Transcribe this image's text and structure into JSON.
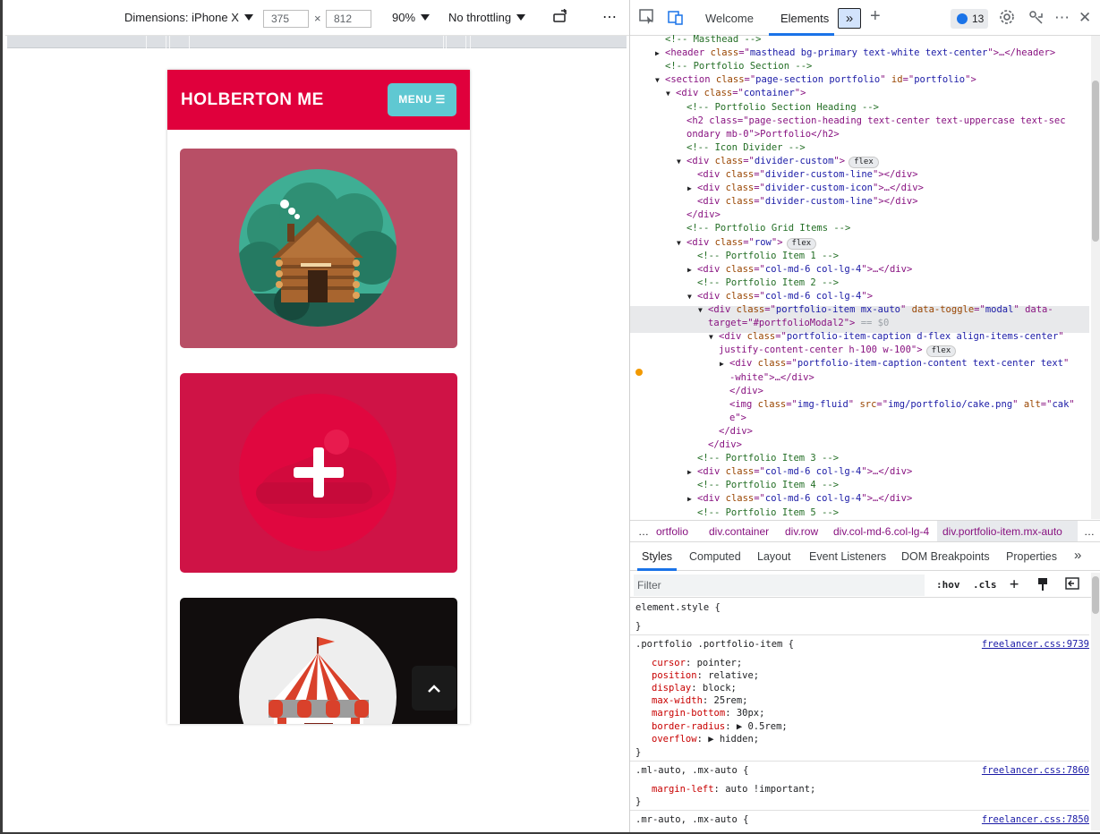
{
  "device_toolbar": {
    "dimensions_label": "Dimensions: iPhone X",
    "width_value": "375",
    "times_sign": "×",
    "height_value": "812",
    "zoom": "90%",
    "throttling": "No throttling",
    "more_label": "⋯"
  },
  "site": {
    "brand": "HOLBERTON ME",
    "menu_label": "MENU ☰",
    "scroll_top_glyph": "⌃"
  },
  "devtools": {
    "tabs": {
      "welcome": "Welcome",
      "elements": "Elements",
      "more": "»",
      "add": "+"
    },
    "issues_count": "13",
    "close_glyph": "✕",
    "more_glyph": "⋯",
    "dom": [
      {
        "indent": 2,
        "arrow": "",
        "kind": "comment",
        "text": "<!-- Masthead -->"
      },
      {
        "indent": 2,
        "arrow": "▶",
        "kind": "open",
        "tag": "header",
        "attrs": [
          [
            "class",
            "masthead bg-primary text-white text-center"
          ]
        ],
        "tail": ">…</header>"
      },
      {
        "indent": 2,
        "arrow": "",
        "kind": "comment",
        "text": "<!-- Portfolio Section -->"
      },
      {
        "indent": 2,
        "arrow": "▼",
        "kind": "open",
        "tag": "section",
        "attrs": [
          [
            "class",
            "page-section portfolio"
          ],
          [
            "id",
            "portfolio"
          ]
        ],
        "tail": ">"
      },
      {
        "indent": 3,
        "arrow": "▼",
        "kind": "open",
        "tag": "div",
        "attrs": [
          [
            "class",
            "container"
          ]
        ],
        "tail": ">"
      },
      {
        "indent": 4,
        "arrow": "",
        "kind": "comment",
        "text": "<!-- Portfolio Section Heading -->"
      },
      {
        "indent": 4,
        "arrow": "",
        "kind": "raw",
        "text": "<h2 class=\"page-section-heading text-center text-uppercase text-sec"
      },
      {
        "indent": 4,
        "arrow": "",
        "kind": "raw",
        "text": "ondary mb-0\">Portfolio</h2>"
      },
      {
        "indent": 4,
        "arrow": "",
        "kind": "comment",
        "text": "<!-- Icon Divider -->"
      },
      {
        "indent": 4,
        "arrow": "▼",
        "kind": "open",
        "tag": "div",
        "attrs": [
          [
            "class",
            "divider-custom"
          ]
        ],
        "tail": ">",
        "badge": "flex"
      },
      {
        "indent": 5,
        "arrow": "",
        "kind": "open",
        "tag": "div",
        "attrs": [
          [
            "class",
            "divider-custom-line"
          ]
        ],
        "tail": "></div>"
      },
      {
        "indent": 5,
        "arrow": "▶",
        "kind": "open",
        "tag": "div",
        "attrs": [
          [
            "class",
            "divider-custom-icon"
          ]
        ],
        "tail": ">…</div>"
      },
      {
        "indent": 5,
        "arrow": "",
        "kind": "open",
        "tag": "div",
        "attrs": [
          [
            "class",
            "divider-custom-line"
          ]
        ],
        "tail": "></div>"
      },
      {
        "indent": 4,
        "arrow": "",
        "kind": "close",
        "text": "</div>"
      },
      {
        "indent": 4,
        "arrow": "",
        "kind": "comment",
        "text": "<!-- Portfolio Grid Items -->"
      },
      {
        "indent": 4,
        "arrow": "▼",
        "kind": "open",
        "tag": "div",
        "attrs": [
          [
            "class",
            "row"
          ]
        ],
        "tail": ">",
        "badge": "flex"
      },
      {
        "indent": 5,
        "arrow": "",
        "kind": "comment",
        "text": "<!-- Portfolio Item 1 -->"
      },
      {
        "indent": 5,
        "arrow": "▶",
        "kind": "open",
        "tag": "div",
        "attrs": [
          [
            "class",
            "col-md-6 col-lg-4"
          ]
        ],
        "tail": ">…</div>"
      },
      {
        "indent": 5,
        "arrow": "",
        "kind": "comment",
        "text": "<!-- Portfolio Item 2 -->"
      },
      {
        "indent": 5,
        "arrow": "▼",
        "kind": "open",
        "tag": "div",
        "attrs": [
          [
            "class",
            "col-md-6 col-lg-4"
          ]
        ],
        "tail": ">"
      },
      {
        "indent": 6,
        "arrow": "▼",
        "kind": "open",
        "tag": "div",
        "attrs": [
          [
            "class",
            "portfolio-item mx-auto"
          ],
          [
            "data-toggle",
            "modal"
          ]
        ],
        "tail": " data-",
        "selected": true
      },
      {
        "indent": 6,
        "arrow": "",
        "kind": "raw2",
        "text": "target=\"#portfolioModal2\">",
        "suffix": " == $0"
      },
      {
        "indent": 7,
        "arrow": "▼",
        "kind": "open",
        "tag": "div",
        "attrs": [
          [
            "class",
            "portfolio-item-caption d-flex align-items-center"
          ]
        ],
        "tail": ""
      },
      {
        "indent": 7,
        "arrow": "",
        "kind": "raw",
        "text": "justify-content-center h-100 w-100\">",
        "badge": "flex"
      },
      {
        "indent": 8,
        "arrow": "▶",
        "kind": "open",
        "tag": "div",
        "attrs": [
          [
            "class",
            "portfolio-item-caption-content text-center text"
          ]
        ],
        "tail": ""
      },
      {
        "indent": 8,
        "arrow": "",
        "kind": "raw",
        "text": "-white\">…</div>"
      },
      {
        "indent": 8,
        "arrow": "",
        "kind": "close",
        "text": "</div>"
      },
      {
        "indent": 8,
        "arrow": "",
        "kind": "open",
        "tag": "img",
        "attrs": [
          [
            "class",
            "img-fluid"
          ],
          [
            "src",
            "img/portfolio/cake.png"
          ],
          [
            "alt",
            "cak"
          ]
        ],
        "tail": ""
      },
      {
        "indent": 8,
        "arrow": "",
        "kind": "raw",
        "text": "e\">"
      },
      {
        "indent": 7,
        "arrow": "",
        "kind": "close",
        "text": "</div>"
      },
      {
        "indent": 6,
        "arrow": "",
        "kind": "close",
        "text": "</div>"
      },
      {
        "indent": 5,
        "arrow": "",
        "kind": "comment",
        "text": "<!-- Portfolio Item 3 -->"
      },
      {
        "indent": 5,
        "arrow": "▶",
        "kind": "open",
        "tag": "div",
        "attrs": [
          [
            "class",
            "col-md-6 col-lg-4"
          ]
        ],
        "tail": ">…</div>"
      },
      {
        "indent": 5,
        "arrow": "",
        "kind": "comment",
        "text": "<!-- Portfolio Item 4 -->"
      },
      {
        "indent": 5,
        "arrow": "▶",
        "kind": "open",
        "tag": "div",
        "attrs": [
          [
            "class",
            "col-md-6 col-lg-4"
          ]
        ],
        "tail": ">…</div>"
      },
      {
        "indent": 5,
        "arrow": "",
        "kind": "comment",
        "text": "<!-- Portfolio Item 5 -->"
      }
    ],
    "breadcrumbs": [
      "…",
      "ortfolio",
      "div.container",
      "div.row",
      "div.col-md-6.col-lg-4",
      "div.portfolio-item.mx-auto",
      "…"
    ],
    "styles_tabs": [
      "Styles",
      "Computed",
      "Layout",
      "Event Listeners",
      "DOM Breakpoints",
      "Properties",
      "»"
    ],
    "filter_placeholder": "Filter",
    "filter_tools": {
      "hov": ":hov",
      "cls": ".cls",
      "add": "+"
    },
    "rules": {
      "element_style_open": "element.style {",
      "element_style_close": "}",
      "r1_selector": ".portfolio .portfolio-item {",
      "r1_source": "freelancer.css:9739",
      "r1_props": [
        [
          "cursor",
          "pointer;"
        ],
        [
          "position",
          "relative;"
        ],
        [
          "display",
          "block;"
        ],
        [
          "max-width",
          "25rem;"
        ],
        [
          "margin-bottom",
          "30px;"
        ],
        [
          "border-radius",
          "▶ 0.5rem;"
        ],
        [
          "overflow",
          "▶ hidden;"
        ]
      ],
      "r1_close": "}",
      "r2_selector": ".ml-auto, .mx-auto {",
      "r2_source": "freelancer.css:7860",
      "r2_prop": [
        "margin-left",
        "auto !important;"
      ],
      "r2_close": "}",
      "r3_selector": ".mr-auto, .mx-auto {",
      "r3_source": "freelancer.css:7850"
    }
  },
  "colors": {
    "brand_red": "#e0003c",
    "menu_teal": "#5fc8d2",
    "card1": "#b84f66",
    "card2": "#cf1346",
    "card3": "#110d0d",
    "devtools_blue": "#1a73e8"
  },
  "icons": [
    "device-toggle-icon",
    "inspect-icon",
    "settings-icon",
    "customize-icon",
    "issues-icon",
    "rotate-icon"
  ]
}
